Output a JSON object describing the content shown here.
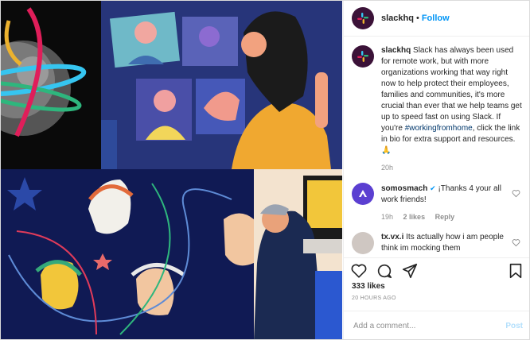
{
  "post": {
    "username": "slackhq",
    "separator": "•",
    "follow_label": "Follow",
    "caption_user": "slackhq",
    "caption_pre": " Slack has always been used for remote work, but with more organizations working that way right now to help protect their employees, families and communities, it's more crucial than ever that we help teams get up to speed fast on using Slack. If you're ",
    "caption_hashtag": "#workingfromhome",
    "caption_post": ", click the link in bio for extra support and resources. 🙏",
    "caption_time": "20h",
    "likes": "333 likes",
    "time_ago": "20 HOURS AGO"
  },
  "comments": [
    {
      "user": "somosmach",
      "verified": "✔",
      "text": " ¡Thanks 4 your all work friends!",
      "time": "19h",
      "likes": "2 likes",
      "reply": "Reply"
    },
    {
      "user": "tx.vx.i",
      "text": " Its actually how i am people think im mocking them"
    }
  ],
  "compose": {
    "placeholder": "Add a comment...",
    "post_label": "Post"
  },
  "icons": [
    "slack-logo-icon",
    "heart-icon",
    "comment-icon",
    "share-icon",
    "bookmark-icon"
  ]
}
